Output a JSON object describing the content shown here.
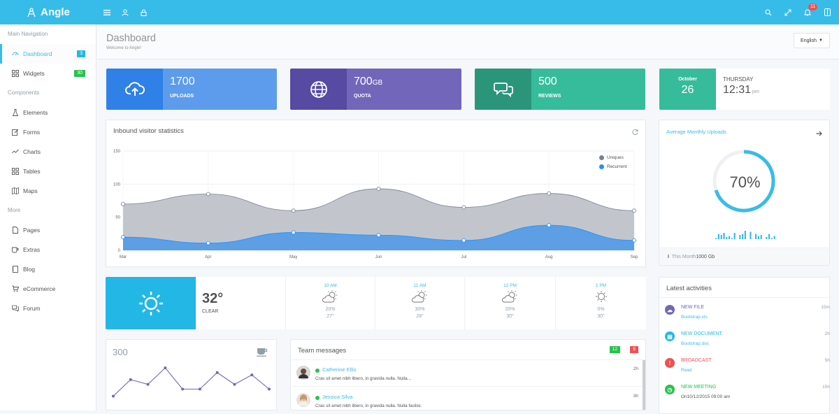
{
  "app": {
    "brand": "Angle"
  },
  "topbar": {
    "notification_count": "11"
  },
  "sidebar": {
    "sections": [
      {
        "heading": "Main Navigation",
        "items": [
          {
            "label": "Dashboard",
            "badge": "3",
            "badge_color": "#23b7e5",
            "active": true,
            "icon": "dashboard-icon"
          },
          {
            "label": "Widgets",
            "badge": "30",
            "badge_color": "#27c24c",
            "icon": "grid-icon"
          }
        ]
      },
      {
        "heading": "Components",
        "items": [
          {
            "label": "Elements",
            "icon": "chemistry-icon"
          },
          {
            "label": "Forms",
            "icon": "note-icon"
          },
          {
            "label": "Charts",
            "icon": "graph-icon"
          },
          {
            "label": "Tables",
            "icon": "grid-icon"
          },
          {
            "label": "Maps",
            "icon": "map-icon"
          }
        ]
      },
      {
        "heading": "More",
        "items": [
          {
            "label": "Pages",
            "icon": "doc-icon"
          },
          {
            "label": "Extras",
            "icon": "cup-icon"
          },
          {
            "label": "Blog",
            "icon": "notebook-icon"
          },
          {
            "label": "eCommerce",
            "icon": "bag-icon"
          },
          {
            "label": "Forum",
            "icon": "bubbles-icon"
          }
        ]
      }
    ]
  },
  "header": {
    "title": "Dashboard",
    "subtitle": "Welcome to Angle!",
    "language": "English"
  },
  "stats": [
    {
      "value": "1700",
      "unit": "",
      "label": "UPLOADS",
      "icon": "cloud-upload-icon",
      "icon_bg": "#2f80e7",
      "text_bg": "#5d9cec"
    },
    {
      "value": "700",
      "unit": "GB",
      "label": "QUOTA",
      "icon": "globe-icon",
      "icon_bg": "#564aa3",
      "text_bg": "#7266ba"
    },
    {
      "value": "500",
      "unit": "",
      "label": "REVIEWS",
      "icon": "bubbles-icon",
      "icon_bg": "#2b957a",
      "text_bg": "#37bc9b"
    }
  ],
  "date_card": {
    "month": "October",
    "day": "26",
    "weekday": "THURSDAY",
    "time": "12:31",
    "ampm": "pm",
    "accent": "#37bc9b"
  },
  "chart_panel": {
    "title": "Inbound visitor statistics"
  },
  "chart_data": {
    "type": "area",
    "x": [
      "Mar",
      "Apr",
      "May",
      "Jun",
      "Jul",
      "Aug",
      "Sep"
    ],
    "ylim": [
      0,
      150
    ],
    "yticks": [
      "150",
      "100",
      "50",
      "0"
    ],
    "series": [
      {
        "name": "Uniques",
        "color": "#768294",
        "values": [
          70,
          85,
          60,
          93,
          65,
          86,
          60
        ]
      },
      {
        "name": "Recurrent",
        "color": "#1f92fe",
        "values": [
          20,
          11,
          27,
          23,
          15,
          38,
          15
        ]
      }
    ],
    "legend": "top-right",
    "grid": true
  },
  "monthly_uploads": {
    "title": "Average Monthly Uploads",
    "percent": "70%",
    "percent_value": 0.7,
    "footer_label": "This Month",
    "footer_value": "1000 Gb",
    "sparkbars": [
      5,
      9,
      8,
      10,
      6,
      7,
      5,
      10,
      4,
      8,
      9,
      12,
      3,
      11,
      4,
      9,
      7,
      8,
      4,
      6,
      9,
      5,
      7
    ]
  },
  "weather": {
    "temp": "32°",
    "condition": "CLEAR",
    "forecast": [
      {
        "time": "10 AM",
        "precip": "20%",
        "temp": "27°"
      },
      {
        "time": "11 AM",
        "precip": "30%",
        "temp": "28°"
      },
      {
        "time": "12 PM",
        "precip": "20%",
        "temp": "30°"
      },
      {
        "time": "1 PM",
        "precip": "0%",
        "temp": "30°"
      }
    ]
  },
  "activities": {
    "title": "Latest activities",
    "items": [
      {
        "title": "NEW FILE",
        "sub": "Bootstrap.xls",
        "time": "15m",
        "color": "#7266ba",
        "title_color": "#7266ba",
        "icon": "cloud-upload-icon"
      },
      {
        "title": "NEW DOCUMENT",
        "sub": "Bootstrap.doc",
        "time": "2h",
        "color": "#23b7e5",
        "title_color": "#23b7e5",
        "icon": "document-icon"
      },
      {
        "title": "BROADCAST",
        "sub": "Read",
        "time": "5h",
        "color": "#f05050",
        "title_color": "#f05050",
        "icon": "alert-icon"
      },
      {
        "title": "NEW MEETING",
        "sub": "On10/12/2015 09:00 am",
        "time": "15h",
        "color": "#27c24c",
        "title_color": "#27c24c",
        "icon": "clock-icon"
      }
    ]
  },
  "sparkline_panel": {
    "value": "300",
    "values": [
      4,
      11,
      9,
      16,
      7,
      7,
      14,
      9,
      13,
      7
    ]
  },
  "messages": {
    "title": "Team messages",
    "badge_green": "12",
    "badge_red": "5",
    "items": [
      {
        "name": "Catherine Ellis",
        "text": "Cras sit amet nibh libero, in gravida nulla. Nulla...",
        "time": "2h"
      },
      {
        "name": "Jessica Silva",
        "text": "Cras sit amet nibh libero, in gravida nulla. Nulla facilisi.",
        "time": "3h"
      }
    ]
  }
}
